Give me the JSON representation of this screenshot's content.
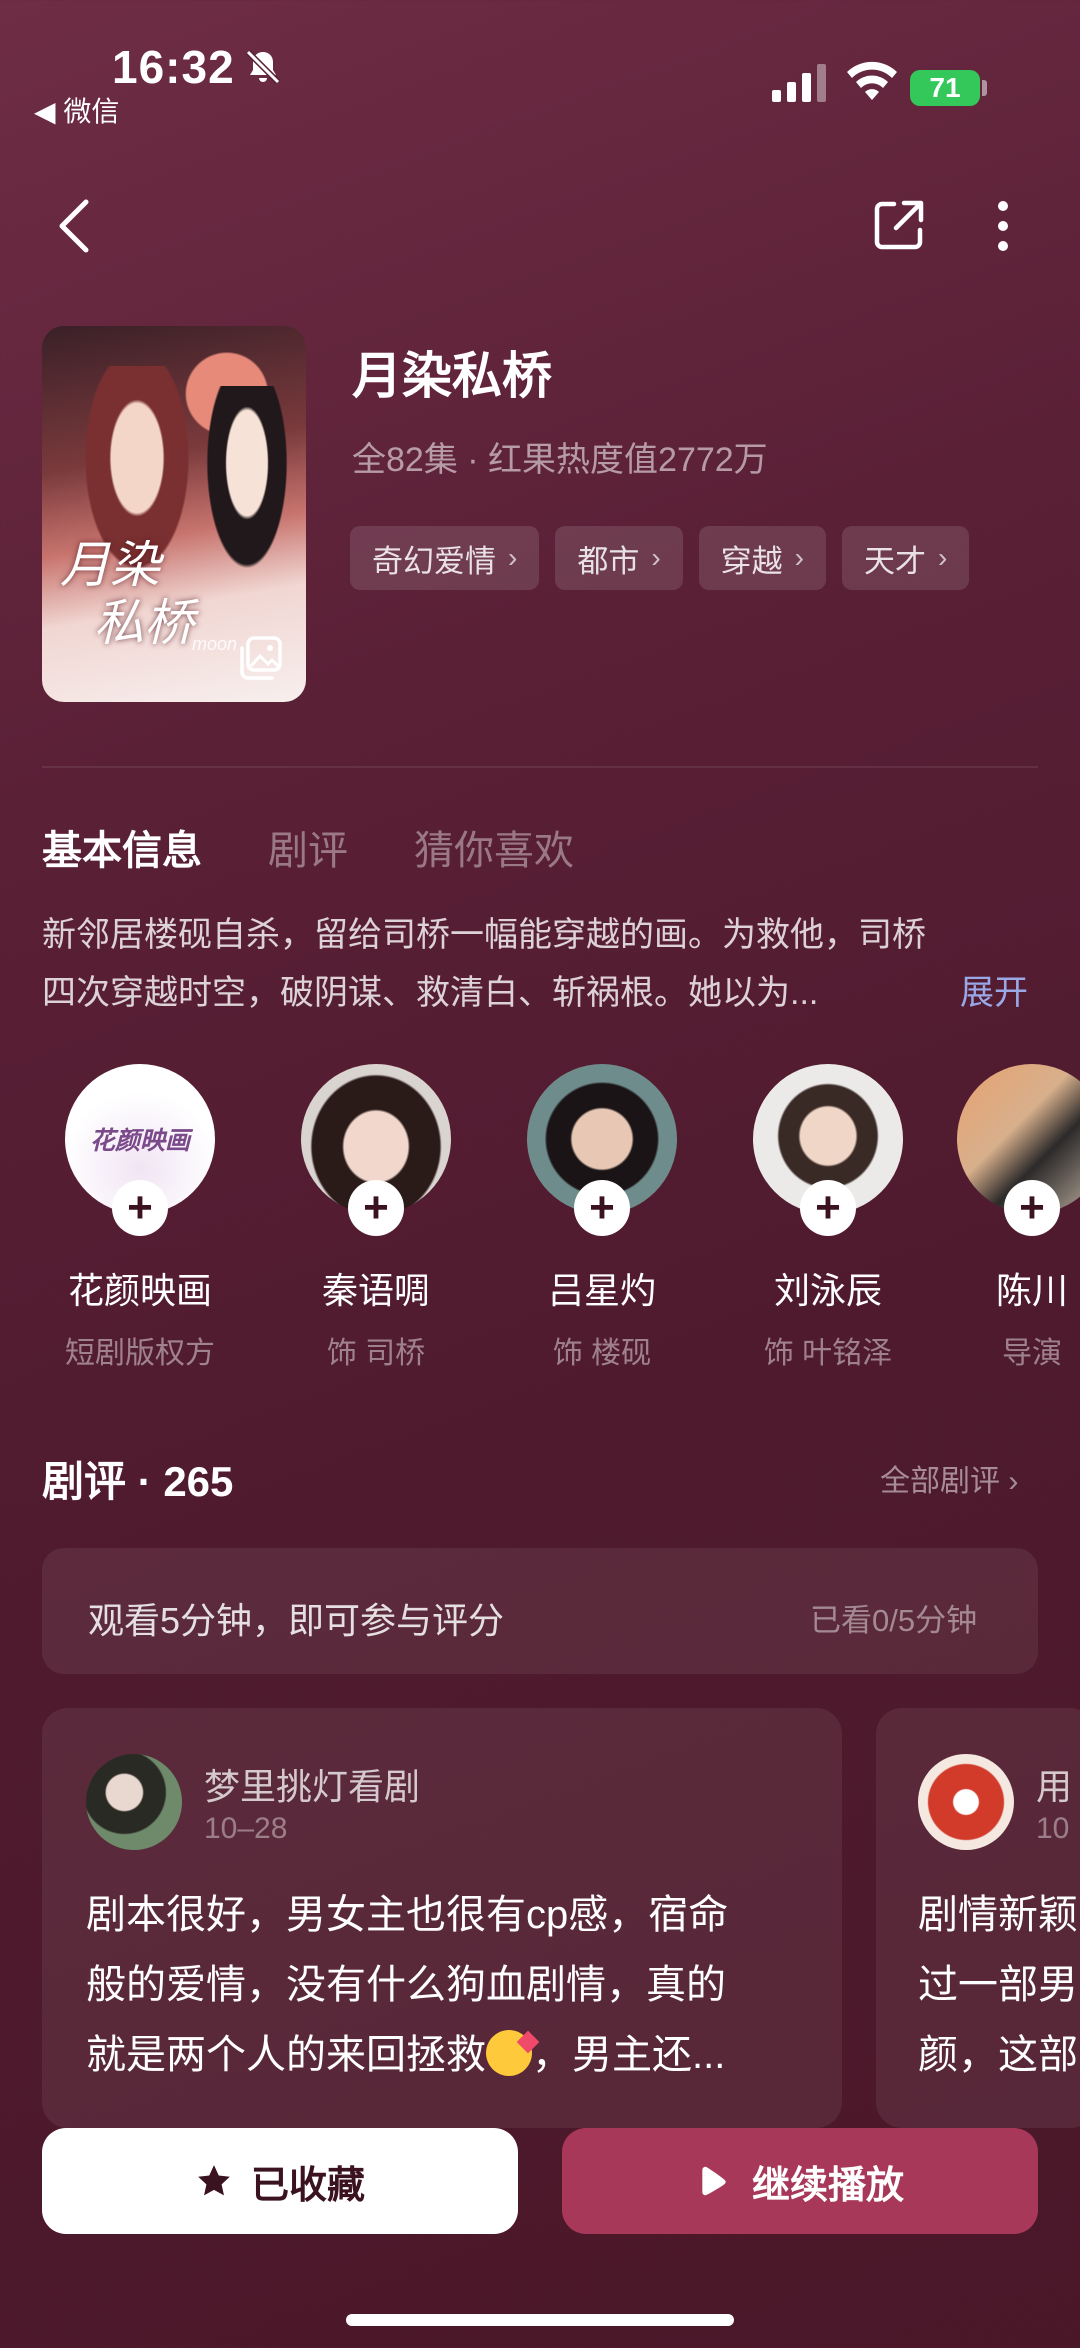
{
  "status_bar": {
    "time": "16:32",
    "back_app": "◀ 微信",
    "battery": "71"
  },
  "drama": {
    "title": "月染私桥",
    "meta": "全82集 · 红果热度值2772万",
    "poster_title_line1": "月染",
    "poster_title_line2": "私桥",
    "poster_subtitle": "moon",
    "tags": [
      "奇幻爱情",
      "都市",
      "穿越",
      "天才"
    ]
  },
  "tabs": [
    "基本信息",
    "剧评",
    "猜你喜欢"
  ],
  "synopsis": {
    "line1": "新邻居楼砚自杀，留给司桥一幅能穿越的画。为救他，司桥",
    "line2": "四次穿越时空，破阴谋、救清白、斩祸根。她以为...",
    "expand": "展开"
  },
  "cast": [
    {
      "name": "花颜映画",
      "role": "短剧版权方",
      "logo": "花颜映画"
    },
    {
      "name": "秦语啁",
      "role": "饰 司桥"
    },
    {
      "name": "吕星灼",
      "role": "饰 楼砚"
    },
    {
      "name": "刘泳辰",
      "role": "饰 叶铭泽"
    },
    {
      "name": "陈川",
      "role": "导演"
    }
  ],
  "reviews": {
    "title": "剧评 · 265",
    "all_link": "全部剧评",
    "rate_prompt": "观看5分钟，即可参与评分",
    "rate_progress": "已看0/5分钟",
    "cards": [
      {
        "user": "梦里挑灯看剧",
        "date": "10–28",
        "line1": "剧本很好，男女主也很有cp感，宿命",
        "line2": "般的爱情，没有什么狗血剧情，真的",
        "line3_a": "就是两个人的来回拯救",
        "line3_b": "，男主还..."
      },
      {
        "user": "用",
        "date": "10",
        "line1": "剧情新颖",
        "line2": "过一部男",
        "line3": "颜，这部"
      }
    ]
  },
  "actions": {
    "favorite": "已收藏",
    "play": "继续播放"
  },
  "colors": {
    "accent_button": "#a8385a",
    "link": "#9aa8e8",
    "battery": "#34c759"
  }
}
